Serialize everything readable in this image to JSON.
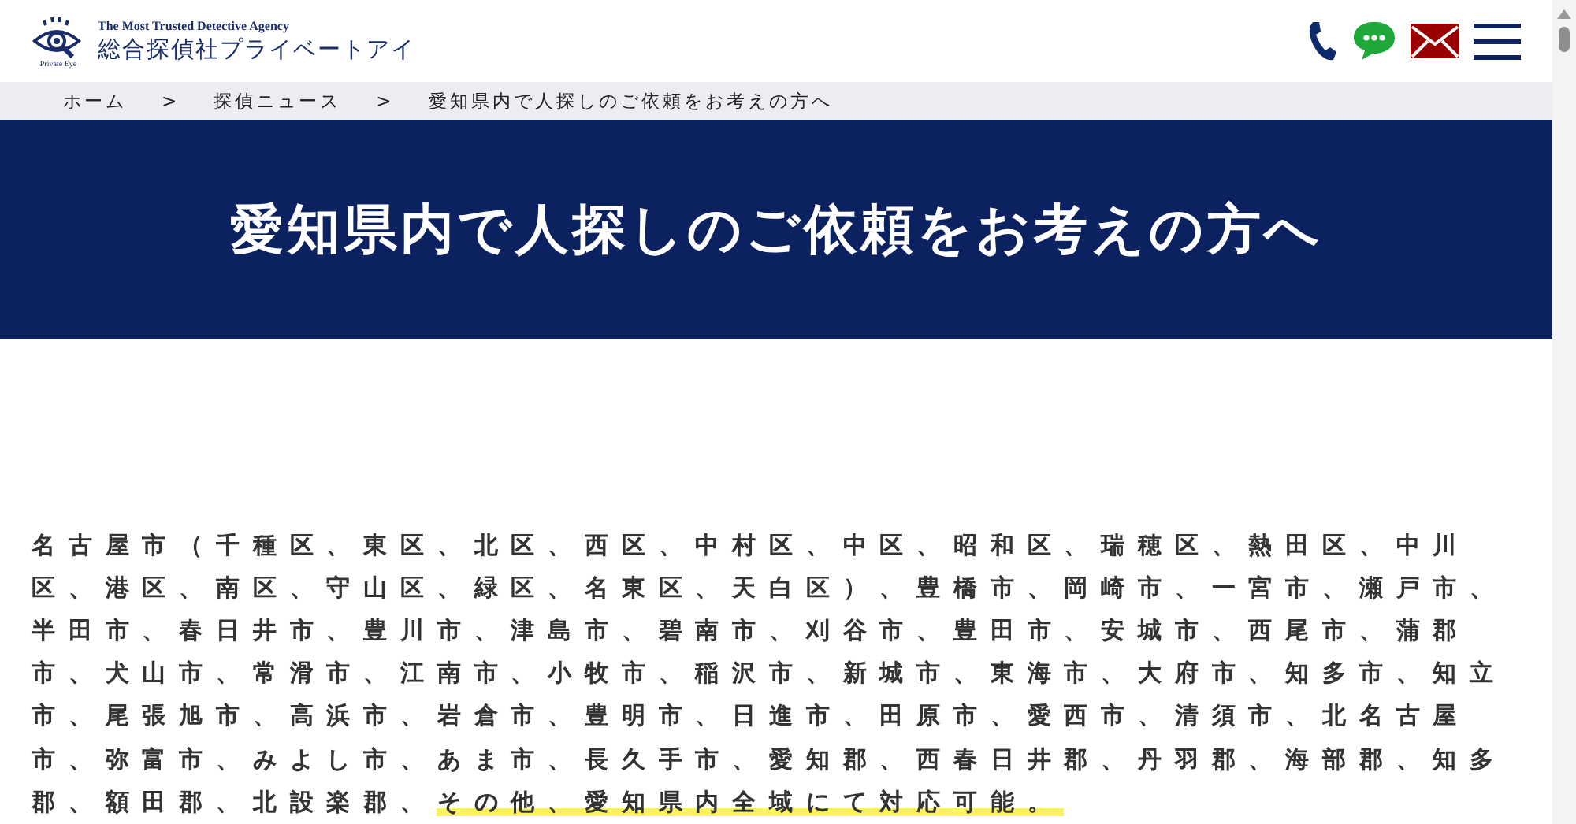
{
  "logo": {
    "mark_caption": "Private Eye",
    "tagline": "The Most Trusted Detective Agency",
    "name": "総合探偵社プライベートアイ"
  },
  "breadcrumb": [
    {
      "label": "ホーム",
      "kind": "link"
    },
    {
      "label": ">",
      "kind": "separator"
    },
    {
      "label": "探偵ニュース",
      "kind": "link"
    },
    {
      "label": ">",
      "kind": "separator"
    },
    {
      "label": "愛知県内で人探しのご依頼をお考えの方へ",
      "kind": "current"
    }
  ],
  "hero": {
    "title": "愛知県内で人探しのご依頼をお考えの方へ"
  },
  "body": {
    "text": "名古屋市（千種区、東区、北区、西区、中村区、中区、昭和区、瑞穂区、熱田区、中川区、港区、南区、守山区、緑区、名東区、天白区）、豊橋市、岡崎市、一宮市、瀬戸市、半田市、春日井市、豊川市、津島市、碧南市、刈谷市、豊田市、安城市、西尾市、蒲郡市、犬山市、常滑市、江南市、小牧市、稲沢市、新城市、東海市、大府市、知多市、知立市、尾張旭市、高浜市、岩倉市、豊明市、日進市、田原市、愛西市、清須市、北名古屋市、弥富市、みよし市、あま市、長久手市、愛知郡、西春日井郡、丹羽郡、海部郡、知多郡、額田郡、北設楽郡、",
    "highlight": "その他、愛知県内全域にて対応可能。"
  }
}
